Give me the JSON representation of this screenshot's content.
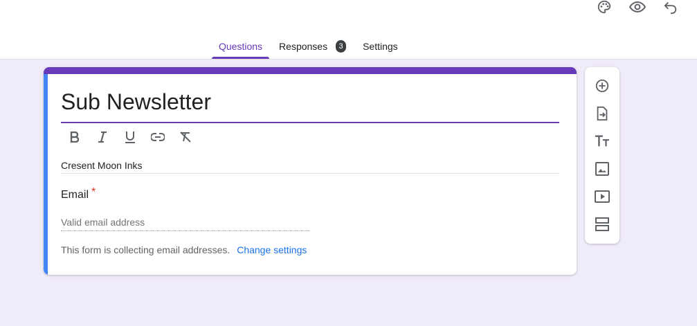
{
  "tabs": [
    {
      "label": "Questions",
      "active": true
    },
    {
      "label": "Responses",
      "badge": "3"
    },
    {
      "label": "Settings"
    }
  ],
  "top_icons": [
    "palette-icon",
    "eye-icon",
    "undo-icon"
  ],
  "form": {
    "title": "Sub Newsletter",
    "description": "Cresent Moon Inks",
    "formatting": [
      "bold-icon",
      "italic-icon",
      "underline-icon",
      "link-icon",
      "clear-format-icon"
    ],
    "email": {
      "label": "Email",
      "required_marker": "*",
      "placeholder": "Valid email address"
    },
    "collecting_text": "This form is collecting email addresses.",
    "change_settings": "Change settings"
  },
  "side_toolbar": [
    "add-question-icon",
    "import-questions-icon",
    "add-title-icon",
    "add-image-icon",
    "add-video-icon",
    "add-section-icon"
  ],
  "colors": {
    "accent": "#673ab7",
    "left_bar": "#4285f4",
    "background": "#f0ebf8",
    "link": "#1a73e8",
    "required": "#d93025"
  }
}
